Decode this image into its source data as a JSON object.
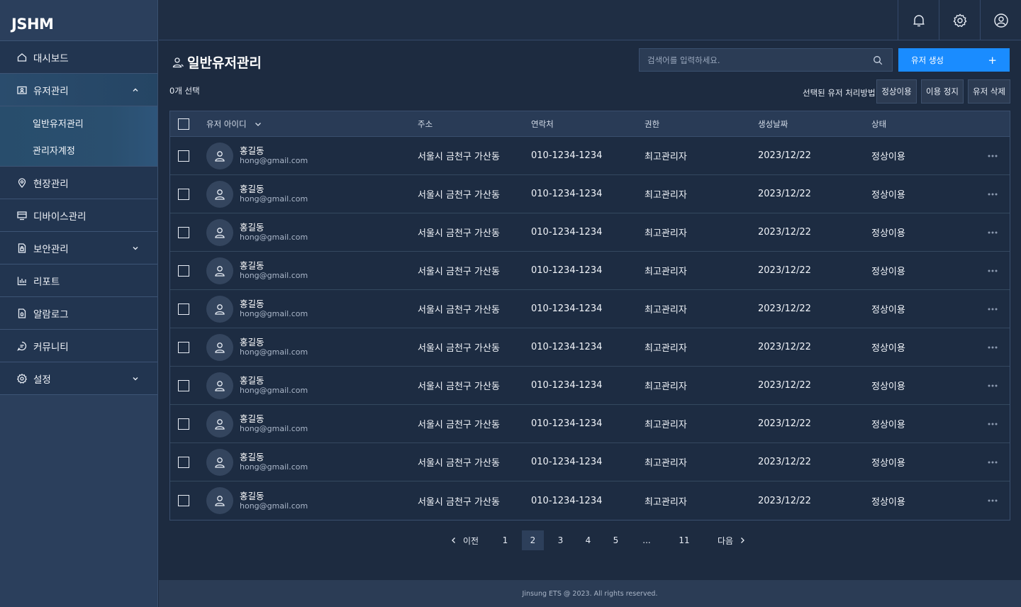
{
  "app": {
    "logo": "JSHM"
  },
  "sidebar": {
    "items": [
      {
        "label": "대시보드",
        "icon": "home-icon"
      },
      {
        "label": "유저관리",
        "icon": "user-folder-icon",
        "expanded": true,
        "children": [
          {
            "label": "일반유저관리"
          },
          {
            "label": "관리자계정"
          }
        ]
      },
      {
        "label": "현장관리",
        "icon": "location-pin-icon"
      },
      {
        "label": "디바이스관리",
        "icon": "device-icon"
      },
      {
        "label": "보안관리",
        "icon": "security-doc-icon",
        "expandable": true
      },
      {
        "label": "리포트",
        "icon": "bar-chart-icon"
      },
      {
        "label": "알람로그",
        "icon": "alarm-doc-icon"
      },
      {
        "label": "커뮤니티",
        "icon": "chat-icon"
      },
      {
        "label": "설정",
        "icon": "gear-icon",
        "expandable": true
      }
    ]
  },
  "topbar": {
    "icons": [
      "bell-icon",
      "settings-icon",
      "account-icon"
    ]
  },
  "page": {
    "title": "일반유저관리",
    "search_placeholder": "검색어를 입력하세요.",
    "create_label": "유저 생성",
    "create_plus": "+",
    "selected_count": "0개 선택",
    "action_label": "선택된 유저 처리방법",
    "actions": [
      "정상이용",
      "이용 정지",
      "유저 삭제"
    ]
  },
  "table": {
    "columns": [
      "유저 아이디",
      "주소",
      "연락처",
      "권한",
      "생성날짜",
      "상태"
    ],
    "rows": [
      {
        "name": "홍길동",
        "email": "hong@gmail.com",
        "address": "서울시 금천구 가산동",
        "phone": "010-1234-1234",
        "role": "최고관리자",
        "date": "2023/12/22",
        "status": "정상이용"
      },
      {
        "name": "홍길동",
        "email": "hong@gmail.com",
        "address": "서울시 금천구 가산동",
        "phone": "010-1234-1234",
        "role": "최고관리자",
        "date": "2023/12/22",
        "status": "정상이용"
      },
      {
        "name": "홍길동",
        "email": "hong@gmail.com",
        "address": "서울시 금천구 가산동",
        "phone": "010-1234-1234",
        "role": "최고관리자",
        "date": "2023/12/22",
        "status": "정상이용"
      },
      {
        "name": "홍길동",
        "email": "hong@gmail.com",
        "address": "서울시 금천구 가산동",
        "phone": "010-1234-1234",
        "role": "최고관리자",
        "date": "2023/12/22",
        "status": "정상이용"
      },
      {
        "name": "홍길동",
        "email": "hong@gmail.com",
        "address": "서울시 금천구 가산동",
        "phone": "010-1234-1234",
        "role": "최고관리자",
        "date": "2023/12/22",
        "status": "정상이용"
      },
      {
        "name": "홍길동",
        "email": "hong@gmail.com",
        "address": "서울시 금천구 가산동",
        "phone": "010-1234-1234",
        "role": "최고관리자",
        "date": "2023/12/22",
        "status": "정상이용"
      },
      {
        "name": "홍길동",
        "email": "hong@gmail.com",
        "address": "서울시 금천구 가산동",
        "phone": "010-1234-1234",
        "role": "최고관리자",
        "date": "2023/12/22",
        "status": "정상이용"
      },
      {
        "name": "홍길동",
        "email": "hong@gmail.com",
        "address": "서울시 금천구 가산동",
        "phone": "010-1234-1234",
        "role": "최고관리자",
        "date": "2023/12/22",
        "status": "정상이용"
      },
      {
        "name": "홍길동",
        "email": "hong@gmail.com",
        "address": "서울시 금천구 가산동",
        "phone": "010-1234-1234",
        "role": "최고관리자",
        "date": "2023/12/22",
        "status": "정상이용"
      },
      {
        "name": "홍길동",
        "email": "hong@gmail.com",
        "address": "서울시 금천구 가산동",
        "phone": "010-1234-1234",
        "role": "최고관리자",
        "date": "2023/12/22",
        "status": "정상이용"
      }
    ]
  },
  "pagination": {
    "prev": "이전",
    "next": "다음",
    "pages": [
      "1",
      "2",
      "3",
      "4",
      "5",
      "...",
      "11"
    ],
    "current": "2"
  },
  "footer": {
    "text": "Jinsung ETS @ 2023. All rights reserved."
  },
  "colors": {
    "accent": "#1a8cff",
    "sidebar": "#2b3f5c",
    "background": "#1d2b40"
  }
}
